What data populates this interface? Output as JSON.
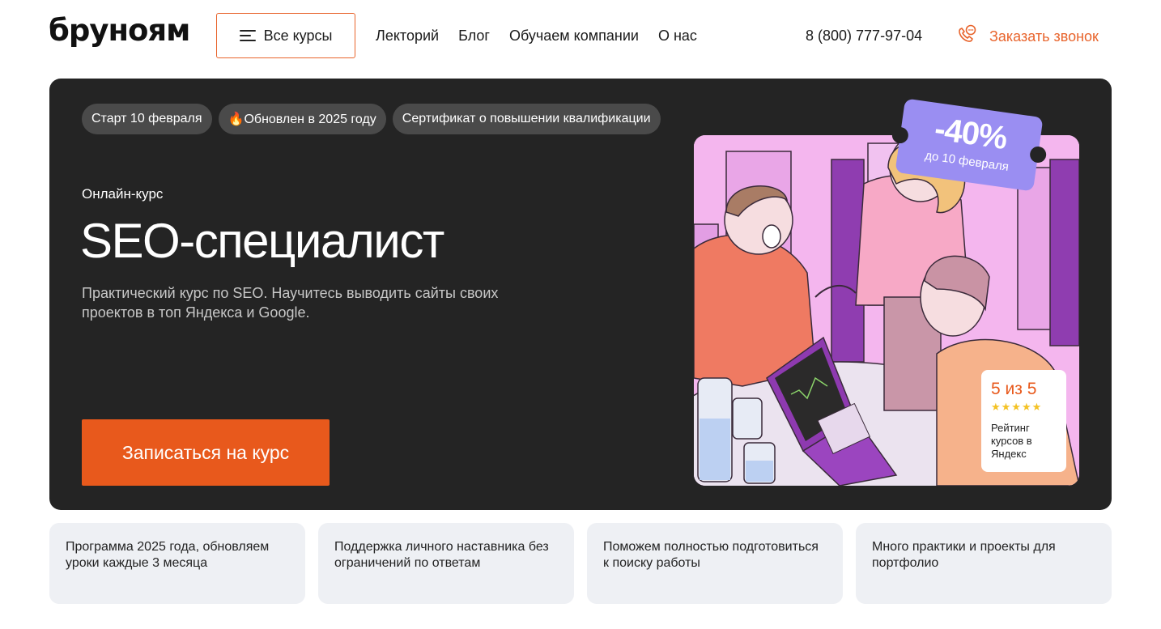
{
  "header": {
    "logo": "бруноям",
    "all_courses_label": "Все курсы",
    "nav": [
      "Лекторий",
      "Блог",
      "Обучаем компании",
      "О нас"
    ],
    "phone": "8 (800) 777-97-04",
    "callback_label": "Заказать звонок"
  },
  "hero": {
    "tags": [
      "Старт 10 февраля",
      "🔥Обновлен в 2025 году",
      "Сертификат о повышении квалификации"
    ],
    "kicker": "Онлайн-курс",
    "title": "SEO-специалист",
    "description": "Практический курс по SEO. Научитесь выводить сайты своих проектов в топ Яндекса и Google.",
    "cta_label": "Записаться на курс",
    "discount": {
      "percent": "-40%",
      "until": "до 10 февраля"
    },
    "rating": {
      "score": "5 из 5",
      "stars": "★★★★★",
      "text": "Рейтинг курсов в Яндекс"
    }
  },
  "features": [
    "Программа 2025 года, обновляем уроки каждые 3 месяца",
    "Поддержка личного наставника без ограничений по ответам",
    "Поможем полностью подготовиться к поиску работы",
    "Много практики и проекты для портфолио"
  ],
  "colors": {
    "accent": "#e8591c",
    "hero_bg": "#242424",
    "discount_bg": "#9a8ef2",
    "card_bg": "#eef0f4"
  }
}
